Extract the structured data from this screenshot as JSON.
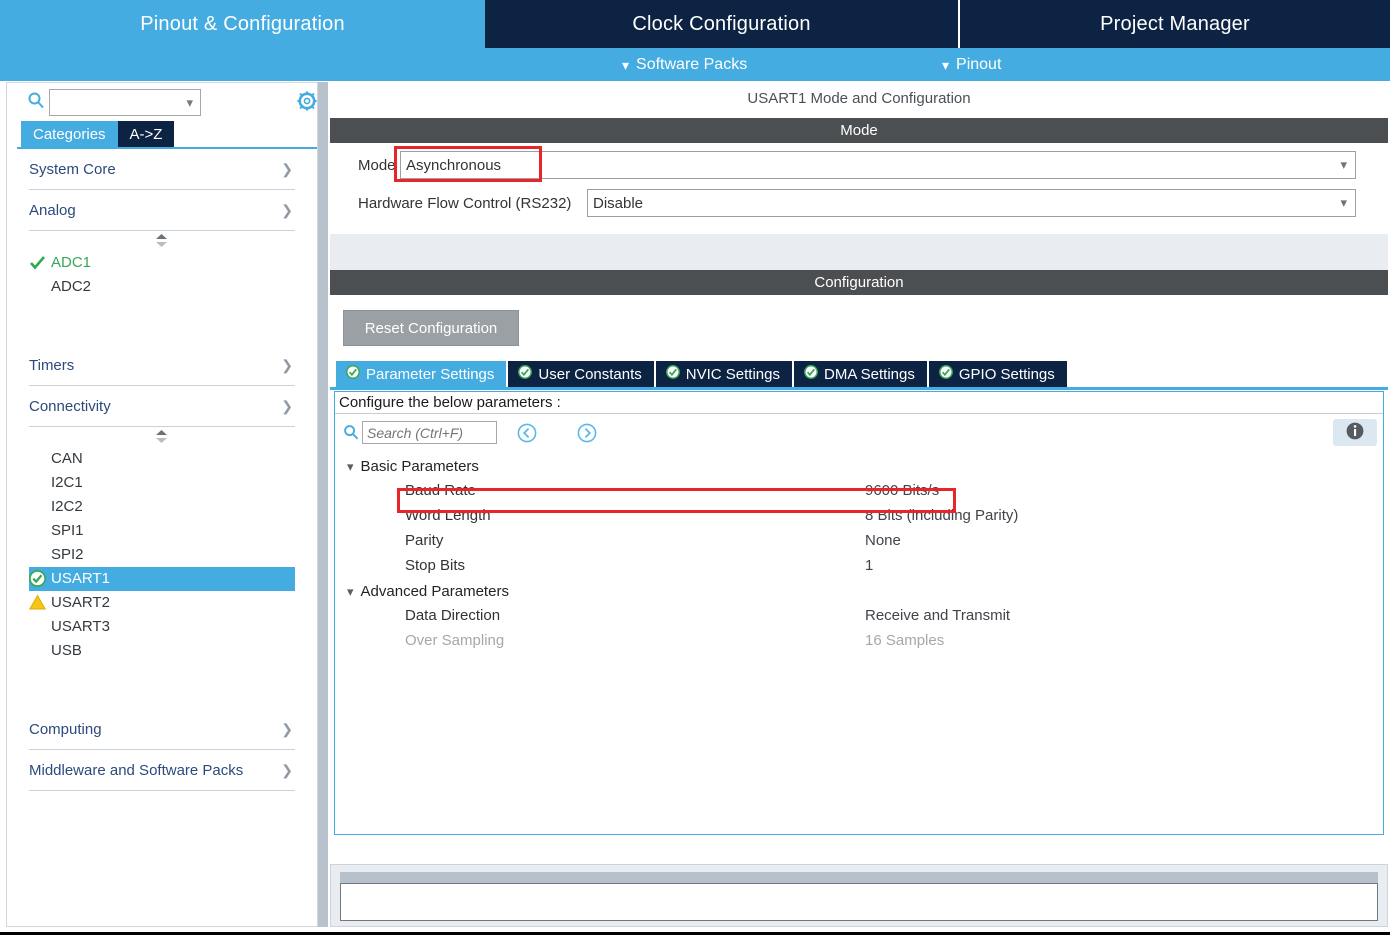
{
  "app": {
    "top_tabs": [
      {
        "label": "Pinout & Configuration",
        "active": true
      },
      {
        "label": "Clock Configuration",
        "active": false
      },
      {
        "label": "Project Manager",
        "active": false
      }
    ],
    "sub_menu": [
      {
        "label": "Software Packs",
        "icon": "chevron-down-icon"
      },
      {
        "label": "Pinout",
        "icon": "chevron-down-icon"
      }
    ],
    "colors": {
      "accent_blue": "#45ace1",
      "dark_navy": "#0d2343",
      "band_gray": "#4c4f51",
      "highlight_red": "#e8262a",
      "ok_green": "#3aa757",
      "warn_yellow": "#f5c518"
    }
  },
  "sidebar": {
    "search_value": "",
    "search_icon": "search-icon",
    "settings_icon": "gear-icon",
    "tabs": [
      {
        "label": "Categories",
        "selected": true
      },
      {
        "label": "A->Z",
        "selected": false
      }
    ],
    "categories": [
      {
        "label": "System Core",
        "arrow": ">",
        "expanded": false
      },
      {
        "label": "Analog",
        "arrow": "v",
        "expanded": true
      },
      {
        "label": "Timers",
        "arrow": ">",
        "expanded": false
      },
      {
        "label": "Connectivity",
        "arrow": "v",
        "expanded": true
      },
      {
        "label": "Computing",
        "arrow": ">",
        "expanded": false
      },
      {
        "label": "Middleware and Software Packs",
        "arrow": ">",
        "expanded": false
      }
    ],
    "analog_items": [
      {
        "label": "ADC1",
        "status": "check-green",
        "state": "configured"
      },
      {
        "label": "ADC2",
        "status": "none",
        "state": "default"
      }
    ],
    "connectivity_items": [
      {
        "label": "CAN",
        "status": "none",
        "state": "default"
      },
      {
        "label": "I2C1",
        "status": "none",
        "state": "default"
      },
      {
        "label": "I2C2",
        "status": "none",
        "state": "default"
      },
      {
        "label": "SPI1",
        "status": "none",
        "state": "default"
      },
      {
        "label": "SPI2",
        "status": "none",
        "state": "default"
      },
      {
        "label": "USART1",
        "status": "check-circle-green",
        "state": "selected"
      },
      {
        "label": "USART2",
        "status": "warning-triangle",
        "state": "default"
      },
      {
        "label": "USART3",
        "status": "none",
        "state": "default"
      },
      {
        "label": "USB",
        "status": "none",
        "state": "default"
      }
    ]
  },
  "main": {
    "title": "USART1 Mode and Configuration",
    "mode_section": {
      "band_label": "Mode",
      "rows": [
        {
          "label": "Mode",
          "value": "Asynchronous",
          "highlighted": true
        },
        {
          "label": "Hardware Flow Control (RS232)",
          "value": "Disable",
          "highlighted": false
        }
      ]
    },
    "configuration_section": {
      "band_label": "Configuration",
      "reset_button": "Reset Configuration",
      "tabs": [
        {
          "label": "Parameter Settings",
          "selected": true,
          "icon": "check-circle-icon"
        },
        {
          "label": "User Constants",
          "selected": false,
          "icon": "check-circle-icon"
        },
        {
          "label": "NVIC Settings",
          "selected": false,
          "icon": "check-circle-icon"
        },
        {
          "label": "DMA Settings",
          "selected": false,
          "icon": "check-circle-icon"
        },
        {
          "label": "GPIO Settings",
          "selected": false,
          "icon": "check-circle-icon"
        }
      ],
      "hint": "Configure the below parameters :",
      "search_placeholder": "Search (Ctrl+F)",
      "search_value": "",
      "nav_prev_icon": "chevron-left-circle-icon",
      "nav_next_icon": "chevron-right-circle-icon",
      "info_icon": "info-icon",
      "groups": [
        {
          "name": "Basic Parameters",
          "expanded": true,
          "rows": [
            {
              "key": "Baud Rate",
              "value": "9600 Bits/s",
              "highlighted": true,
              "dim": false
            },
            {
              "key": "Word Length",
              "value": "8 Bits (including Parity)",
              "highlighted": false,
              "dim": false
            },
            {
              "key": "Parity",
              "value": "None",
              "highlighted": false,
              "dim": false
            },
            {
              "key": "Stop Bits",
              "value": "1",
              "highlighted": false,
              "dim": false
            }
          ]
        },
        {
          "name": "Advanced Parameters",
          "expanded": true,
          "rows": [
            {
              "key": "Data Direction",
              "value": "Receive and Transmit",
              "highlighted": false,
              "dim": false
            },
            {
              "key": "Over Sampling",
              "value": "16 Samples",
              "highlighted": false,
              "dim": true
            }
          ]
        }
      ]
    },
    "bottom_panel": {
      "content": ""
    }
  }
}
